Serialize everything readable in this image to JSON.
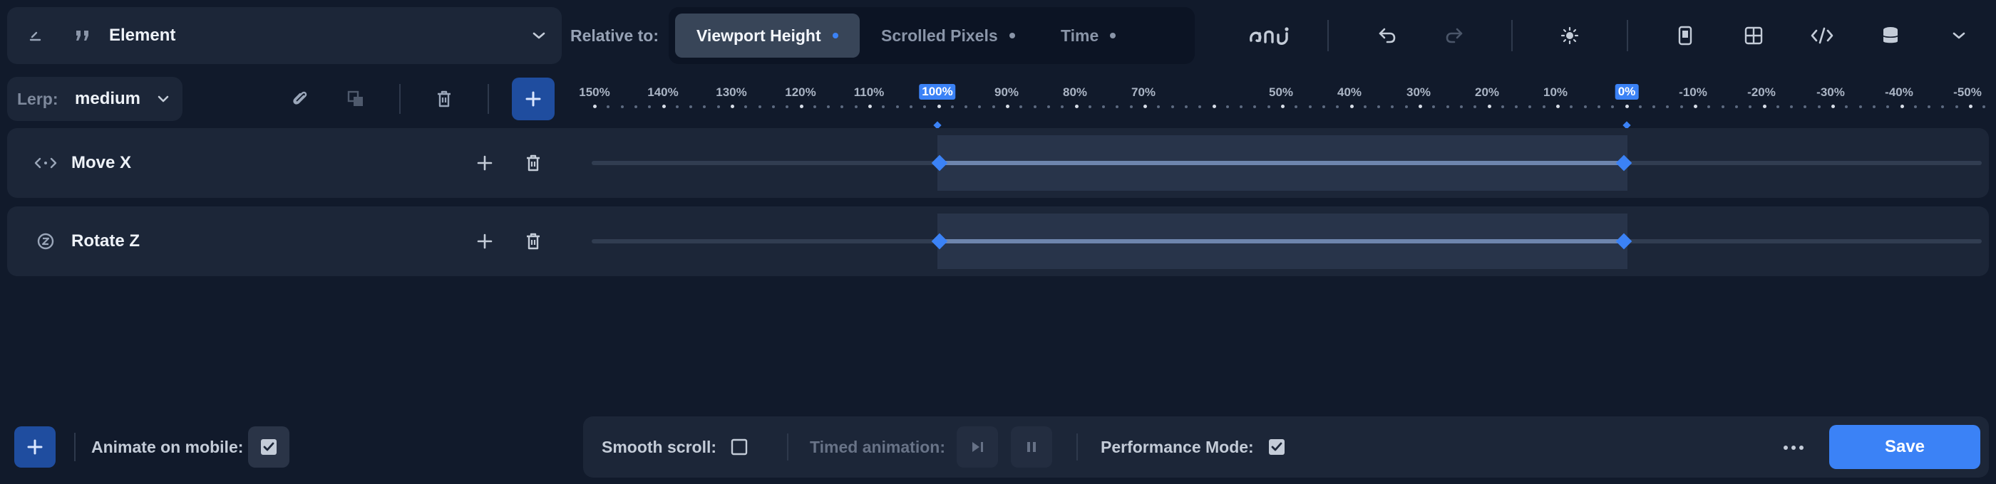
{
  "header": {
    "element_label": "Element",
    "relative_label": "Relative to:",
    "relative_options": [
      {
        "label": "Viewport Height",
        "active": true
      },
      {
        "label": "Scrolled Pixels",
        "active": false
      },
      {
        "label": "Time",
        "active": false
      }
    ],
    "icons": [
      "edit-icon",
      "quote-icon",
      "chevron-down-icon",
      "ani-logo",
      "undo-icon",
      "redo-icon",
      "sun-icon",
      "mobile-icon",
      "grid-icon",
      "code-icon",
      "database-icon",
      "chevron-down-icon"
    ]
  },
  "toolbar": {
    "lerp_key": "Lerp:",
    "lerp_value": "medium"
  },
  "ruler": {
    "ticks": [
      "150%",
      "140%",
      "130%",
      "120%",
      "110%",
      "100%",
      "90%",
      "80%",
      "70%",
      "50%",
      "40%",
      "30%",
      "20%",
      "10%",
      "0%",
      "-10%",
      "-20%",
      "-30%",
      "-40%",
      "-50%"
    ],
    "start_marker": "100%",
    "end_marker": "0%"
  },
  "tracks": [
    {
      "name": "Move X",
      "icon": "move-x-icon"
    },
    {
      "name": "Rotate Z",
      "icon": "rotate-z-icon"
    }
  ],
  "footer": {
    "animate_mobile_label": "Animate on mobile:",
    "animate_mobile_checked": true,
    "smooth_scroll_label": "Smooth scroll:",
    "smooth_scroll_checked": false,
    "timed_animation_label": "Timed animation:",
    "performance_mode_label": "Performance Mode:",
    "performance_mode_checked": true,
    "save_label": "Save"
  },
  "colors": {
    "accent": "#3b82f6",
    "background": "#111a2b",
    "panel": "#1c2638"
  }
}
